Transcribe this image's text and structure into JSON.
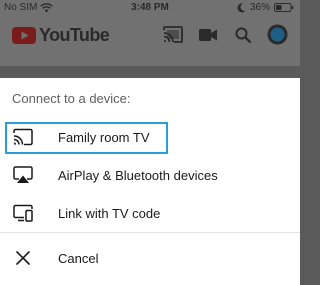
{
  "status_bar": {
    "carrier": "No SIM",
    "time": "3:48 PM",
    "battery": "36%"
  },
  "app": {
    "logo_text": "YouTube",
    "brand_color": "#ff0000"
  },
  "header_icons": [
    "cast-icon",
    "camera-icon",
    "search-icon",
    "account-icon"
  ],
  "sheet": {
    "title": "Connect to a device:",
    "highlight_color": "#2a9fd6",
    "options": [
      {
        "label": "Family room TV",
        "icon": "cast-icon",
        "highlighted": true
      },
      {
        "label": "AirPlay & Bluetooth devices",
        "icon": "airplay-icon",
        "highlighted": false
      },
      {
        "label": "Link with TV code",
        "icon": "tv-code-icon",
        "highlighted": false
      }
    ],
    "cancel_label": "Cancel"
  }
}
